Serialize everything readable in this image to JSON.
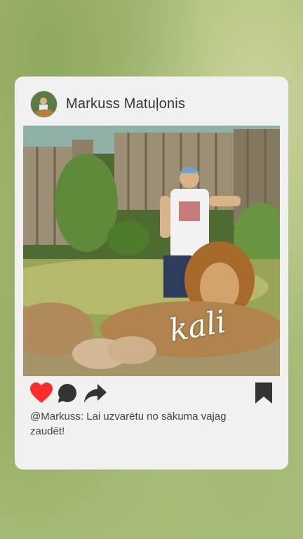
{
  "post": {
    "username": "Markuss Matuļonis",
    "caption": "@Markuss: Lai uzvarētu no sākuma vajag zaudēt!",
    "photo_text": "kali"
  },
  "icons": {
    "like": "heart-icon",
    "comment": "comment-icon",
    "share": "share-icon",
    "save": "bookmark-icon"
  },
  "colors": {
    "like": "#ff2c2c",
    "icon": "#333333",
    "card": "#f1f1f1"
  }
}
